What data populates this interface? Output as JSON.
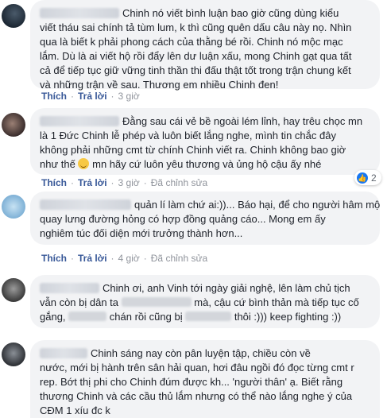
{
  "comments": [
    {
      "lines": [
        "Chinh nó viết bình luận bao giờ cũng dùng kiểu",
        "viết tháu sai chính tả tùm lum, k thì cũng quên dấu câu này nọ. Nhìn",
        "qua là biết k phải phong cách của thằng bé rồi. Chinh nó mộc mạc",
        "lắm. Dù là ai viết hộ rồi đẩy lên dư luận xấu, mong Chinh gạt qua tất",
        "cả để tiếp tục giữ vững tinh thần thi đấu thật tốt trong trận chung kết",
        "và những trận về sau. Thương em nhiều Chinh đen!"
      ],
      "actions": {
        "like": "Thích",
        "reply": "Trả lời",
        "time": "3 giờ"
      }
    },
    {
      "lines": [
        "Đằng sau cái vẻ bề ngoài lém lỉnh, hay trêu chọc mn",
        "là 1 Đức Chinh lễ phép và luôn biết lắng nghe, mình tin chắc đây",
        "không phải những cmt từ chính Chinh viết ra. Chinh không bao giờ",
        "như thế",
        "mn hãy cứ luôn yêu thương và ủng hộ cậu ấy nhé"
      ],
      "reaction_count": "2",
      "actions": {
        "like": "Thích",
        "reply": "Trả lời",
        "time": "3 giờ",
        "edited": "Đã chỉnh sửa"
      }
    },
    {
      "lines": [
        "quản lí làm chứ ai:))... Báo hại, để cho người hâm mộ",
        "quay lưng đường hỏng có hợp đồng quảng cáo... Mong em ấy",
        "nghiêm túc đối diện mới trưởng thành hơn..."
      ],
      "reaction_count": "",
      "actions": {
        "like": "Thích",
        "reply": "Trả lời",
        "time": "4 giờ",
        "edited": "Đã chỉnh sửa"
      }
    },
    {
      "lines": [
        "Chinh ơi, anh Vinh tới ngày giải nghệ, lên làm chủ tịch",
        "vẫn còn bị dân ta",
        "mà, cậu cứ bình thản mà tiếp tục cố",
        "gắng,",
        "chán rồi cũng bị",
        "thôi :))) keep fighting :))"
      ]
    },
    {
      "lines": [
        "Chinh sáng nay còn pân luyện tập, chiều còn về",
        "nước, mới bị hành trên sân hải quan, hơi đâu ngồi đó đọc từng cmt r",
        "rep. Bớt thị phi cho Chinh đúm được kh... 'người thân' ạ. Biết rằng",
        "thương Chinh và các cầu thủ lắm nhưng có thể nào lắng nghe ý của",
        "CĐM 1 xíu đc k"
      ]
    }
  ]
}
